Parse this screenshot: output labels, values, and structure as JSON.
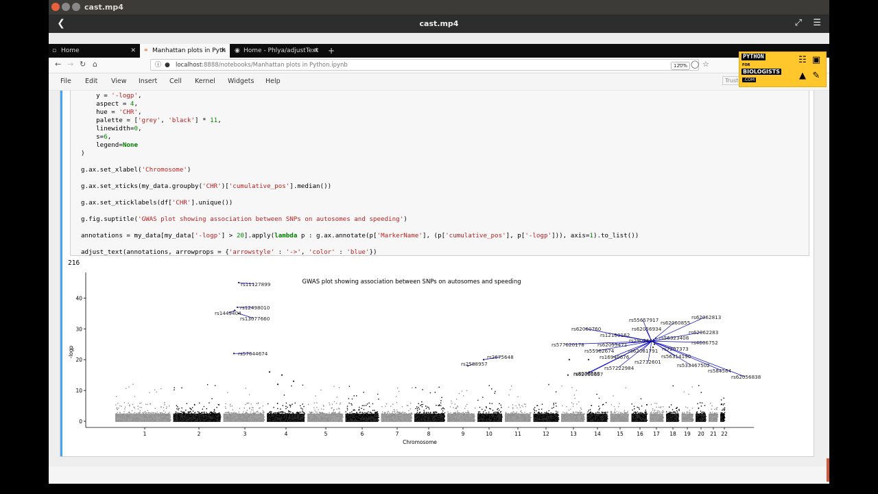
{
  "player": {
    "window_title": "cast.mp4",
    "bar_title": "cast.mp4"
  },
  "browser": {
    "tabs": [
      {
        "label": "Home"
      },
      {
        "label": "Manhattan plots in Pyth"
      },
      {
        "label": "Home - Phlya/adjustText"
      }
    ],
    "new_tab": "+",
    "url_host": "localhost",
    "url_rest": ":8888/notebooks/Manhattan plots in Python.ipynb",
    "zoom": "120%"
  },
  "jupyter": {
    "menu": [
      "File",
      "Edit",
      "View",
      "Insert",
      "Cell",
      "Kernel",
      "Widgets",
      "Help"
    ],
    "trusted": "Truste"
  },
  "logo": {
    "line1": "PYTHON",
    "line2": "FOR",
    "line3": "BIOLOGISTS",
    "line4": ".COM"
  },
  "output_number": "216",
  "colors": {
    "grey": "#8e8e8e",
    "black": "#000000",
    "arrow": "#0000cc",
    "cell_bar": "#42a5f5"
  },
  "chart_data": {
    "type": "scatter",
    "title": "GWAS plot showing association between SNPs on autosomes and speeding",
    "xlabel": "Chromosome",
    "ylabel": "-logp",
    "ylim": [
      -2,
      47
    ],
    "yticks": [
      0,
      10,
      20,
      30,
      40
    ],
    "xtick_labels": [
      "1",
      "2",
      "3",
      "4",
      "5",
      "6",
      "7",
      "8",
      "9",
      "10",
      "11",
      "12",
      "13",
      "14",
      "15",
      "16",
      "17",
      "18",
      "19",
      "20",
      "21",
      "22"
    ],
    "annotations": [
      {
        "label": "rs11127899"
      },
      {
        "label": "rs12498010"
      },
      {
        "label": "rs1449404"
      },
      {
        "label": "rs13077660"
      },
      {
        "label": "rs57644674"
      },
      {
        "label": "rs2588957"
      },
      {
        "label": "rs2675648"
      },
      {
        "label": "rs62060760"
      },
      {
        "label": "rs12150162"
      },
      {
        "label": "rs55657917"
      },
      {
        "label": "rs62056934"
      },
      {
        "label": "rs62060855"
      },
      {
        "label": "rs62062813"
      },
      {
        "label": "rs62062283"
      },
      {
        "label": "rs4606752"
      },
      {
        "label": "rs577620178"
      },
      {
        "label": "rs62055471"
      },
      {
        "label": "rs56323408"
      },
      {
        "label": "rs55962674"
      },
      {
        "label": "rs16940676"
      },
      {
        "label": "rs2732601"
      },
      {
        "label": "rs57222984"
      },
      {
        "label": "rs7207373"
      },
      {
        "label": "rs56314190"
      },
      {
        "label": "rs533467502"
      },
      {
        "label": "rs584564"
      },
      {
        "label": "rs62056838"
      },
      {
        "label": "rs62060657"
      },
      {
        "label": "rs8070650"
      },
      {
        "label": "rs2902661"
      },
      {
        "label": "rs62081791"
      }
    ]
  }
}
